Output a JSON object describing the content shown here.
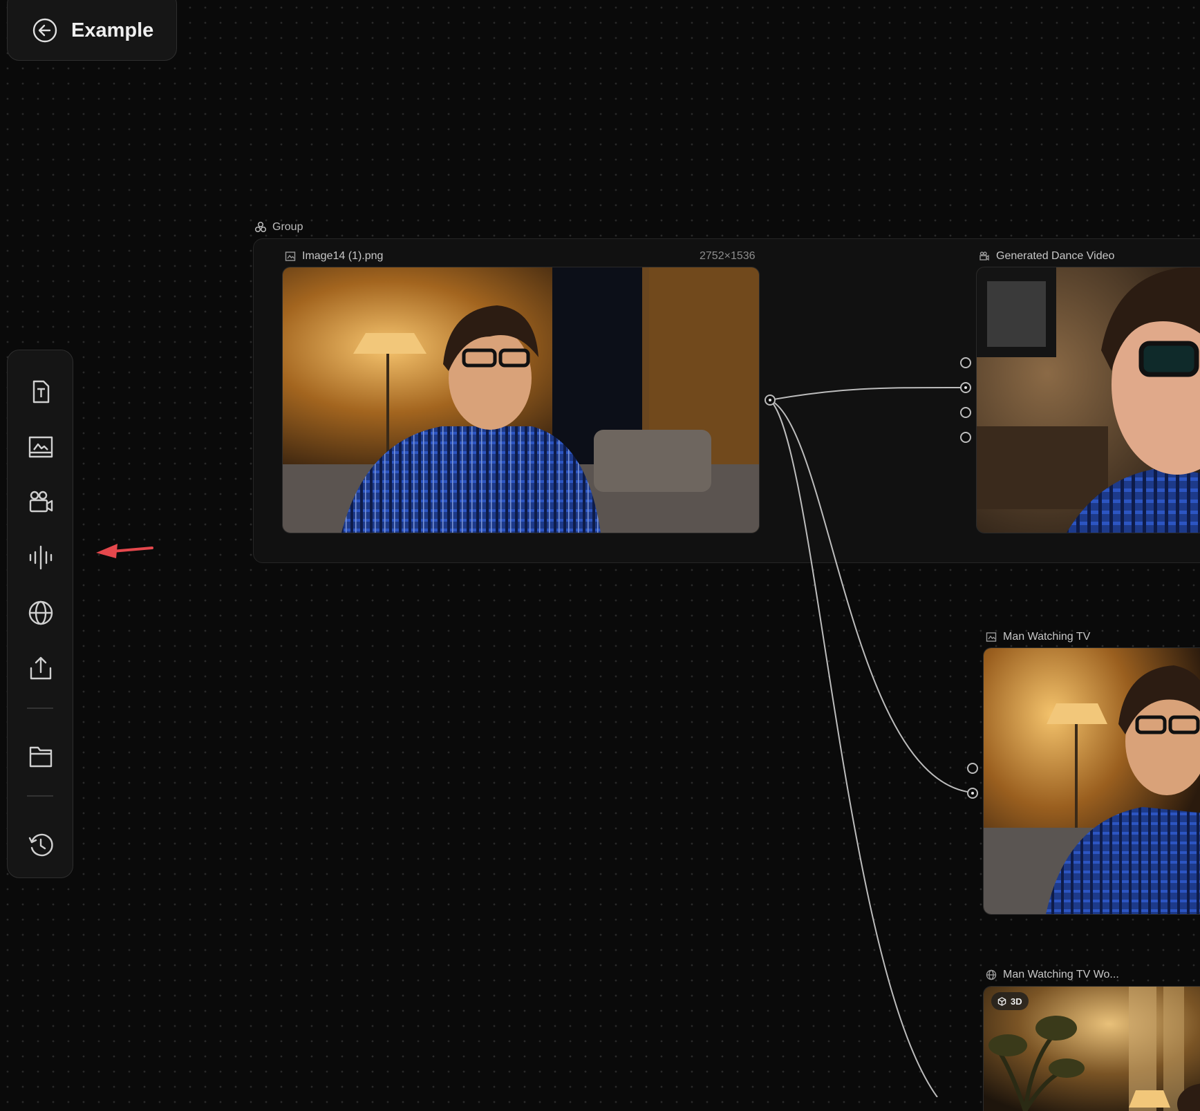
{
  "header": {
    "title": "Example",
    "back_icon": "arrow-left-circle-icon"
  },
  "toolbar": {
    "items": [
      {
        "name": "text",
        "icon": "text-box-icon"
      },
      {
        "name": "image",
        "icon": "image-icon"
      },
      {
        "name": "video",
        "icon": "video-camera-icon"
      },
      {
        "name": "audio",
        "icon": "audio-waveform-icon"
      },
      {
        "name": "world",
        "icon": "globe-icon"
      },
      {
        "name": "upload",
        "icon": "upload-icon"
      },
      {
        "name": "folder",
        "icon": "folder-icon"
      },
      {
        "name": "history",
        "icon": "history-icon"
      }
    ]
  },
  "annotation": {
    "arrow_color": "#e5484d"
  },
  "group": {
    "label": "Group"
  },
  "nodes": {
    "source_image": {
      "title": "Image14 (1).png",
      "dimensions": "2752×1536"
    },
    "dance_video": {
      "title": "Generated Dance Video"
    },
    "man_tv": {
      "title": "Man Watching TV"
    },
    "man_tv_world": {
      "title": "Man Watching TV Wo...",
      "badge": "3D"
    }
  },
  "colors": {
    "canvas": "#0a0a0a",
    "wire": "#bdbdbd"
  }
}
